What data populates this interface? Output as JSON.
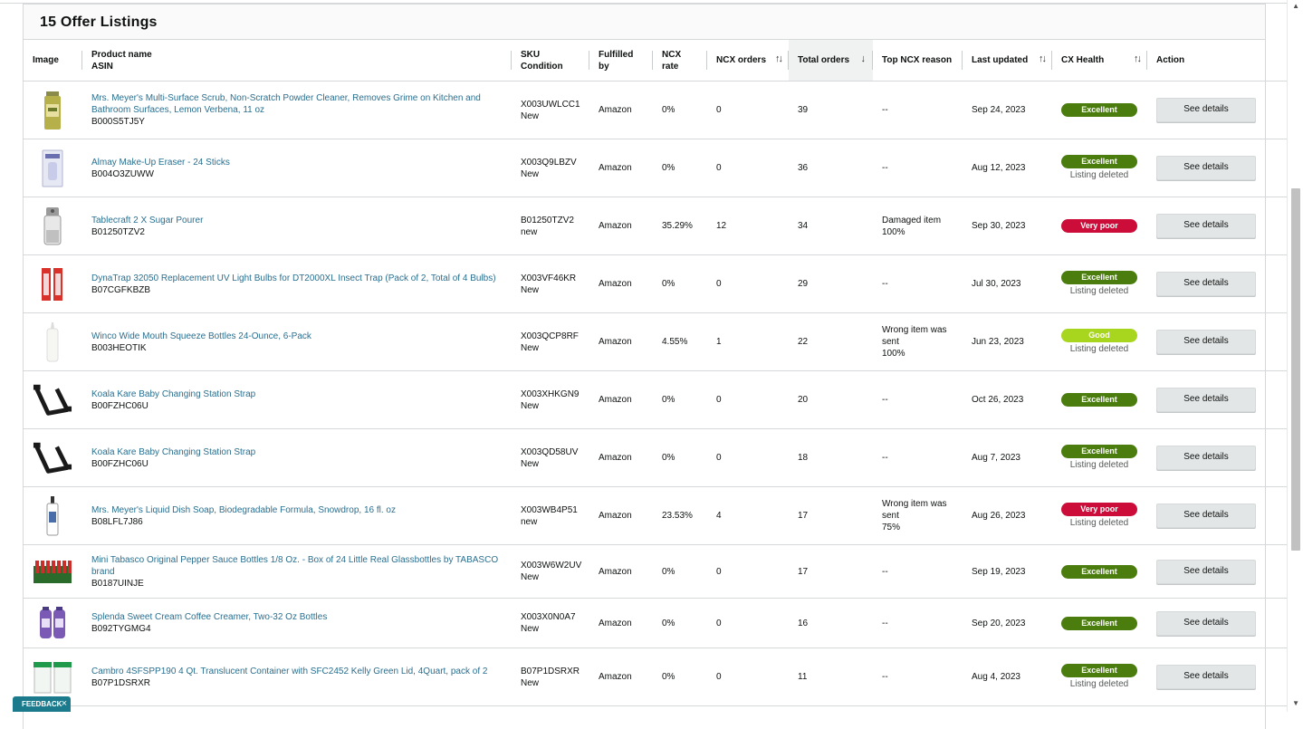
{
  "title": "15 Offer Listings",
  "columns": {
    "image": "Image",
    "product_name": "Product name",
    "asin": "ASIN",
    "sku": "SKU",
    "condition": "Condition",
    "fulfilled_by": "Fulfilled by",
    "ncx_rate": "NCX rate",
    "ncx_orders": "NCX orders",
    "total_orders": "Total orders",
    "top_ncx_reason": "Top NCX reason",
    "last_updated": "Last updated",
    "cx_health": "CX Health",
    "action": "Action"
  },
  "rows": [
    {
      "name": "Mrs. Meyer's Multi-Surface Scrub, Non-Scratch Powder Cleaner, Removes Grime on Kitchen and Bathroom Surfaces, Lemon Verbena, 11 oz",
      "asin": "B000S5TJ5Y",
      "sku": "X003UWLCC1",
      "condition": "New",
      "fulfilled": "Amazon",
      "rate": "0%",
      "orders": "0",
      "total": "39",
      "reason": "--",
      "reason2": "",
      "reason3": "",
      "updated": "Sep 24, 2023",
      "health": "Excellent",
      "health_class": "b-exc",
      "deleted": "",
      "action": "See details",
      "image_icon": "cleaner-can-icon"
    },
    {
      "name": "Almay Make-Up Eraser - 24 Sticks",
      "asin": "B004O3ZUWW",
      "sku": "X003Q9LBZV",
      "condition": "New",
      "fulfilled": "Amazon",
      "rate": "0%",
      "orders": "0",
      "total": "36",
      "reason": "--",
      "reason2": "",
      "reason3": "",
      "updated": "Aug 12, 2023",
      "health": "Excellent",
      "health_class": "b-exc",
      "deleted": "Listing deleted",
      "action": "See details",
      "image_icon": "makeup-box-icon"
    },
    {
      "name": "Tablecraft 2 X Sugar Pourer",
      "asin": "B01250TZV2",
      "sku": "B01250TZV2",
      "condition": "new",
      "fulfilled": "Amazon",
      "rate": "35.29%",
      "orders": "12",
      "total": "34",
      "reason": "Damaged item",
      "reason2": "100%",
      "reason3": "",
      "updated": "Sep 30, 2023",
      "health": "Very poor",
      "health_class": "b-poor",
      "deleted": "",
      "action": "See details",
      "image_icon": "sugar-pourer-icon"
    },
    {
      "name": "DynaTrap 32050 Replacement UV Light Bulbs for DT2000XL Insect Trap (Pack of 2, Total of 4 Bulbs)",
      "asin": "B07CGFKBZB",
      "sku": "X003VF46KR",
      "condition": "New",
      "fulfilled": "Amazon",
      "rate": "0%",
      "orders": "0",
      "total": "29",
      "reason": "--",
      "reason2": "",
      "reason3": "",
      "updated": "Jul 30, 2023",
      "health": "Excellent",
      "health_class": "b-exc",
      "deleted": "Listing deleted",
      "action": "See details",
      "image_icon": "uv-bulbs-icon"
    },
    {
      "name": "Winco Wide Mouth Squeeze Bottles 24-Ounce, 6-Pack",
      "asin": "B003HEOTIK",
      "sku": "X003QCP8RF",
      "condition": "New",
      "fulfilled": "Amazon",
      "rate": "4.55%",
      "orders": "1",
      "total": "22",
      "reason": "Wrong item was",
      "reason2": "sent",
      "reason3": "100%",
      "updated": "Jun 23, 2023",
      "health": "Good",
      "health_class": "b-good",
      "deleted": "Listing deleted",
      "action": "See details",
      "image_icon": "squeeze-bottle-icon"
    },
    {
      "name": "Koala Kare Baby Changing Station Strap",
      "asin": "B00FZHC06U",
      "sku": "X003XHKGN9",
      "condition": "New",
      "fulfilled": "Amazon",
      "rate": "0%",
      "orders": "0",
      "total": "20",
      "reason": "--",
      "reason2": "",
      "reason3": "",
      "updated": "Oct 26, 2023",
      "health": "Excellent",
      "health_class": "b-exc",
      "deleted": "",
      "action": "See details",
      "image_icon": "strap-icon"
    },
    {
      "name": "Koala Kare Baby Changing Station Strap",
      "asin": "B00FZHC06U",
      "sku": "X003QD58UV",
      "condition": "New",
      "fulfilled": "Amazon",
      "rate": "0%",
      "orders": "0",
      "total": "18",
      "reason": "--",
      "reason2": "",
      "reason3": "",
      "updated": "Aug 7, 2023",
      "health": "Excellent",
      "health_class": "b-exc",
      "deleted": "Listing deleted",
      "action": "See details",
      "image_icon": "strap-icon"
    },
    {
      "name": "Mrs. Meyer's Liquid Dish Soap, Biodegradable Formula, Snowdrop, 16 fl. oz",
      "asin": "B08LFL7J86",
      "sku": "X003WB4P51",
      "condition": "new",
      "fulfilled": "Amazon",
      "rate": "23.53%",
      "orders": "4",
      "total": "17",
      "reason": "Wrong item was",
      "reason2": "sent",
      "reason3": "75%",
      "updated": "Aug 26, 2023",
      "health": "Very poor",
      "health_class": "b-poor",
      "deleted": "Listing deleted",
      "action": "See details",
      "image_icon": "soap-bottle-icon"
    },
    {
      "name": "Mini Tabasco Original Pepper Sauce Bottles 1/8 Oz. - Box of 24 Little Real Glassbottles by TABASCO brand",
      "asin": "B0187UINJE",
      "sku": "X003W6W2UV",
      "condition": "New",
      "fulfilled": "Amazon",
      "rate": "0%",
      "orders": "0",
      "total": "17",
      "reason": "--",
      "reason2": "",
      "reason3": "",
      "updated": "Sep 19, 2023",
      "health": "Excellent",
      "health_class": "b-exc",
      "deleted": "",
      "action": "See details",
      "image_icon": "tabasco-box-icon"
    },
    {
      "name": "Splenda Sweet Cream Coffee Creamer, Two-32 Oz Bottles",
      "asin": "B092TYGMG4",
      "sku": "X003X0N0A7",
      "condition": "New",
      "fulfilled": "Amazon",
      "rate": "0%",
      "orders": "0",
      "total": "16",
      "reason": "--",
      "reason2": "",
      "reason3": "",
      "updated": "Sep 20, 2023",
      "health": "Excellent",
      "health_class": "b-exc",
      "deleted": "",
      "action": "See details",
      "image_icon": "creamer-bottles-icon"
    },
    {
      "name": "Cambro 4SFSPP190 4 Qt. Translucent Container with SFC2452 Kelly Green Lid, 4Quart, pack of 2",
      "asin": "B07P1DSRXR",
      "sku": "B07P1DSRXR",
      "condition": "New",
      "fulfilled": "Amazon",
      "rate": "0%",
      "orders": "0",
      "total": "11",
      "reason": "--",
      "reason2": "",
      "reason3": "",
      "updated": "Aug 4, 2023",
      "health": "Excellent",
      "health_class": "b-exc",
      "deleted": "Listing deleted",
      "action": "See details",
      "image_icon": "containers-icon"
    }
  ],
  "feedback": "FEEDBACK",
  "colors": {
    "excellent": "#4a7c0e",
    "very_poor": "#cc0c39",
    "good": "#a8d51e",
    "link": "#2a6f8f"
  }
}
